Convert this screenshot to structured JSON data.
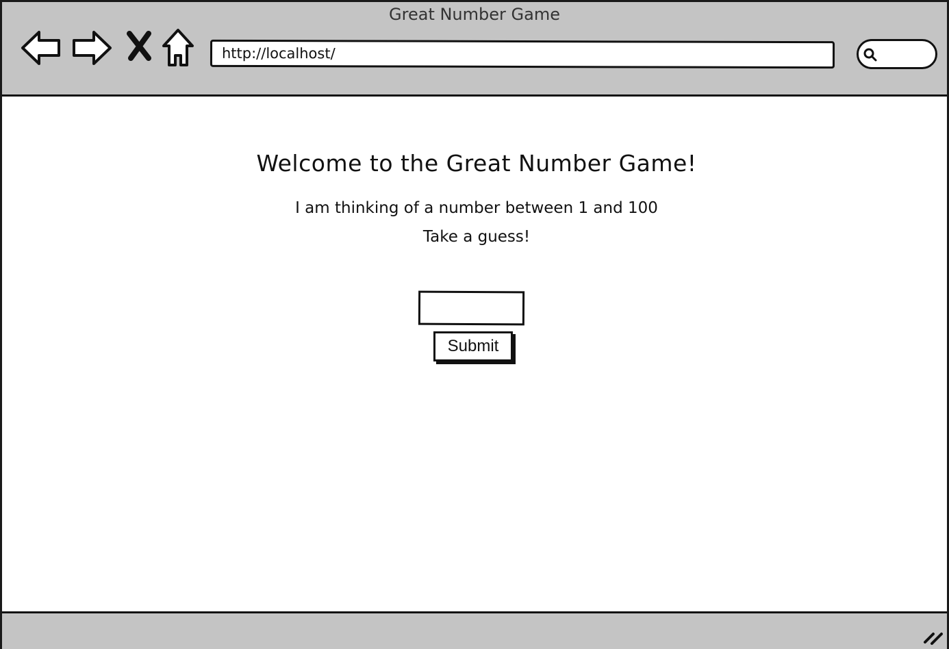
{
  "window": {
    "title": "Great Number Game"
  },
  "toolbar": {
    "back_icon": "back-arrow-icon",
    "forward_icon": "forward-arrow-icon",
    "stop_icon": "stop-x-icon",
    "home_icon": "home-icon",
    "url": "http://localhost/",
    "search_icon": "search-icon"
  },
  "page": {
    "heading": "Welcome to the Great Number Game!",
    "line1": "I am thinking of a number between 1 and 100",
    "line2": "Take a guess!",
    "guess_value": "",
    "submit_label": "Submit"
  },
  "colors": {
    "chrome": "#c4c4c4",
    "ink": "#111111",
    "background": "#ffffff"
  }
}
